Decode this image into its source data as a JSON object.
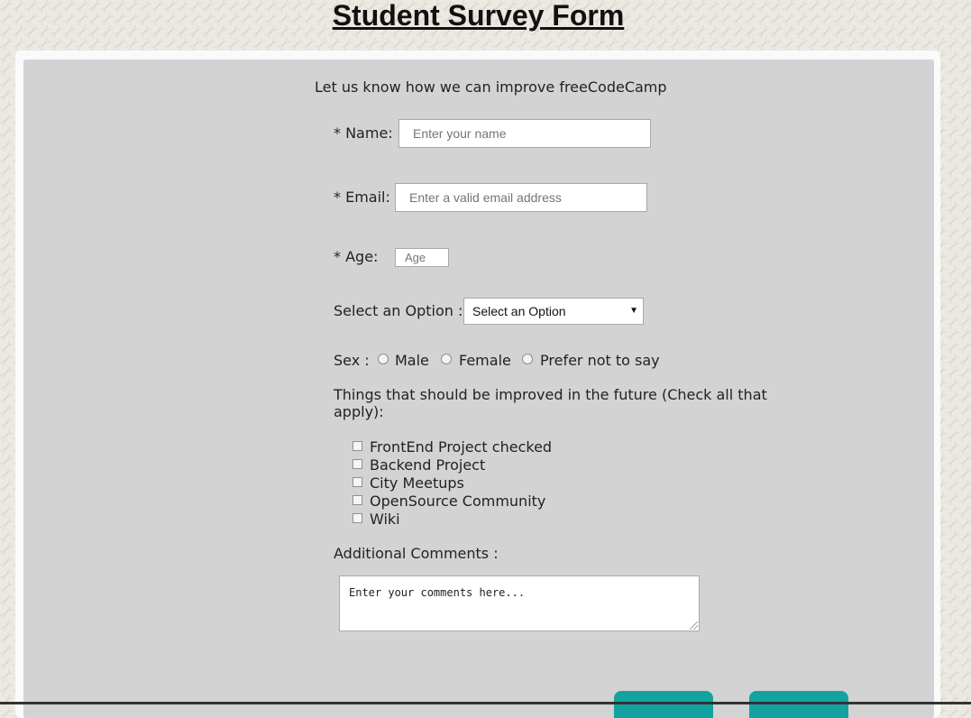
{
  "title": "Student Survey Form",
  "description": "Let us know how we can improve freeCodeCamp",
  "fields": {
    "name": {
      "label": "* Name:",
      "placeholder": "Enter your name"
    },
    "email": {
      "label": "* Email:",
      "placeholder": "Enter a valid email address"
    },
    "age": {
      "label": "* Age:",
      "placeholder": "Age"
    }
  },
  "dropdown": {
    "label": "Select an Option :",
    "selected": "Select an Option"
  },
  "sex": {
    "label": "Sex :",
    "options": [
      "Male",
      "Female",
      "Prefer not to say"
    ]
  },
  "improvements": {
    "label": "Things that should be improved in the future (Check all that apply):",
    "label_line1": "Things that should be improved in the future (Check all that",
    "label_line2": "apply):",
    "options": [
      "FrontEnd Project checked",
      "Backend Project",
      "City Meetups",
      "OpenSource Community",
      "Wiki"
    ]
  },
  "comments": {
    "label": "Additional Comments :",
    "placeholder": "Enter your comments here..."
  },
  "icons": {
    "dropdown_arrow": "caret-down-icon",
    "resize": "resize-grip-icon"
  },
  "colors": {
    "panel": "#d3d3d3",
    "button": "#12a3a1",
    "background": "#ece9e2"
  }
}
